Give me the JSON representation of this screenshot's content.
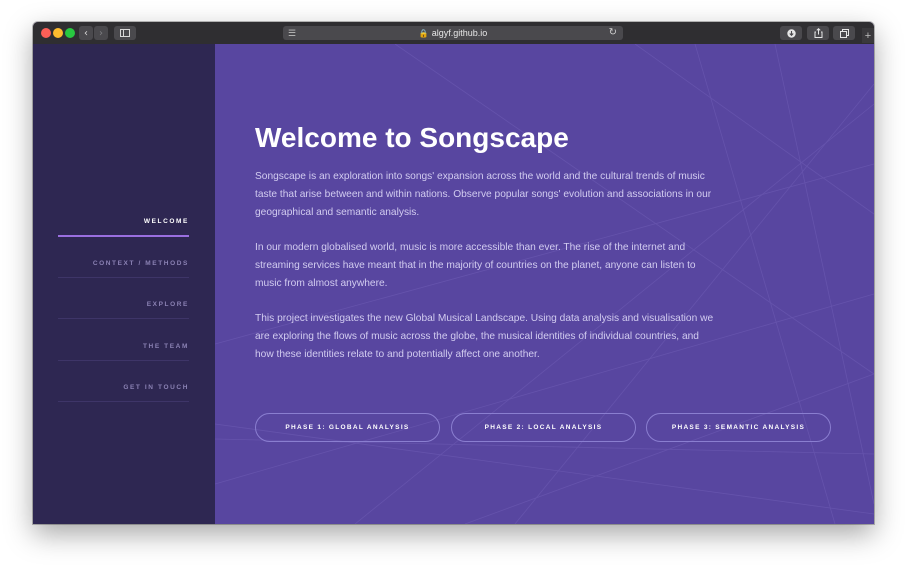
{
  "browser": {
    "url": "algyf.github.io",
    "icons": [
      "back-icon",
      "forward-icon",
      "sidebar-icon",
      "reader-icon",
      "lock-icon",
      "reload-icon",
      "download-icon",
      "share-icon",
      "tabs-icon",
      "new-tab-icon"
    ]
  },
  "sidebar": {
    "items": [
      {
        "label": "WELCOME",
        "active": true
      },
      {
        "label": "CONTEXT / METHODS",
        "active": false
      },
      {
        "label": "EXPLORE",
        "active": false
      },
      {
        "label": "THE TEAM",
        "active": false
      },
      {
        "label": "GET IN TOUCH",
        "active": false
      }
    ]
  },
  "main": {
    "title": "Welcome to Songscape",
    "paragraphs": [
      "Songscape is an exploration into songs' expansion across the world and the cultural trends of music taste that arise between and within nations. Observe popular songs' evolution and associations in our geographical and semantic analysis.",
      "In our modern globalised world, music is more accessible than ever. The rise of the internet and streaming services have meant that in the majority of countries on the planet, anyone can listen to music from almost anywhere.",
      "This project investigates the new Global Musical Landscape. Using data analysis and visualisation we are exploring the flows of music across the globe, the musical identities of individual countries, and how these identities relate to and potentially affect one another."
    ],
    "phases": [
      "PHASE 1: GLOBAL ANALYSIS",
      "PHASE 2: LOCAL ANALYSIS",
      "PHASE 3: SEMANTIC ANALYSIS"
    ]
  },
  "colors": {
    "sidebar_bg": "#2e2752",
    "main_bg": "#5846a0",
    "active_underline": "#9a6fe0"
  }
}
